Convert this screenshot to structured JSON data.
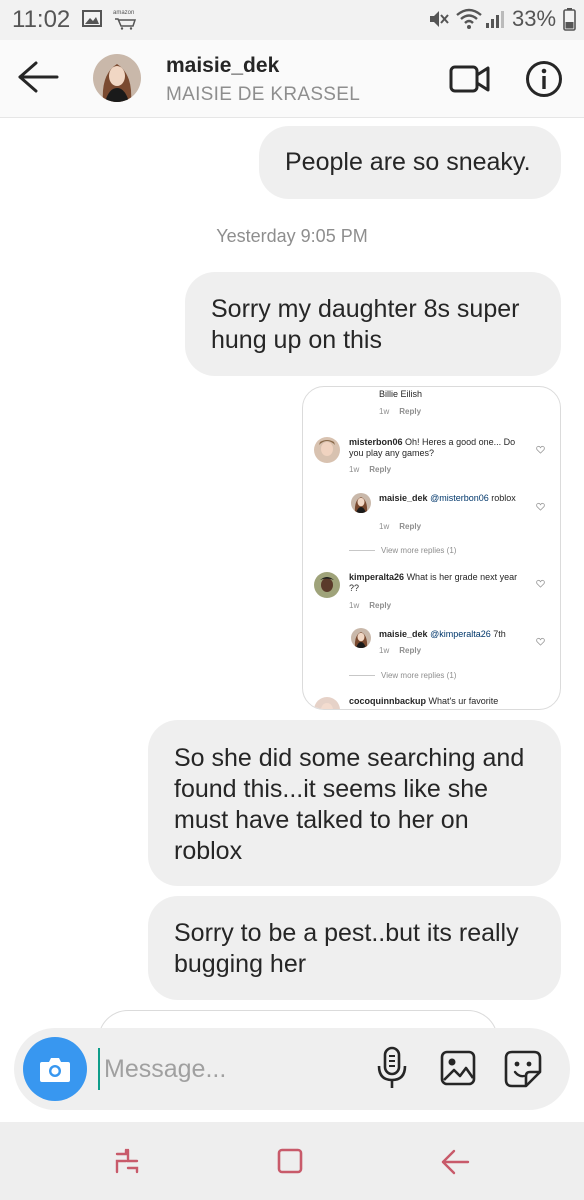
{
  "status_bar": {
    "time": "11:02",
    "amazon_label": "amazon",
    "battery": "33%"
  },
  "header": {
    "username": "maisie_dek",
    "full_name": "MAISIE DE KRASSEL"
  },
  "messages": [
    {
      "text": "People are so sneaky."
    },
    {
      "text": "Sorry my daughter 8s super hung up on this"
    },
    {
      "text": "So she did some searching and found this...it seems like she must have talked to her on roblox"
    },
    {
      "text": "Sorry to be a pest..but its really bugging her"
    }
  ],
  "timestamp": "Yesterday 9:05 PM",
  "shared_screenshot": {
    "top_comment": {
      "text": "Billie Eilish",
      "age": "1w",
      "reply": "Reply"
    },
    "comments": [
      {
        "user": "misterbon06",
        "text": "Oh! Heres a good one... Do you play any games?",
        "age": "1w",
        "reply": "Reply"
      },
      {
        "user": "maisie_dek",
        "mention": "@misterbon06",
        "text": "roblox",
        "age": "1w",
        "reply": "Reply"
      },
      {
        "user": "kimperalta26",
        "text": "What is her grade next year ??",
        "age": "1w",
        "reply": "Reply"
      },
      {
        "user": "maisie_dek",
        "mention": "@kimperalta26",
        "text": "7th",
        "age": "1w",
        "reply": "Reply"
      },
      {
        "user": "cocoquinnbackup",
        "text": "What's ur favorite"
      }
    ],
    "view_more_1": "View more replies (1)",
    "view_more_2": "View more replies (1)"
  },
  "composer": {
    "placeholder": "Message..."
  },
  "colors": {
    "camera_button": "#3897f0",
    "bubble": "#efefef",
    "accent_teal": "#0f9d8a"
  },
  "icons": [
    "back-arrow-icon",
    "video-call-icon",
    "info-icon",
    "camera-icon",
    "microphone-icon",
    "gallery-icon",
    "sticker-icon"
  ]
}
